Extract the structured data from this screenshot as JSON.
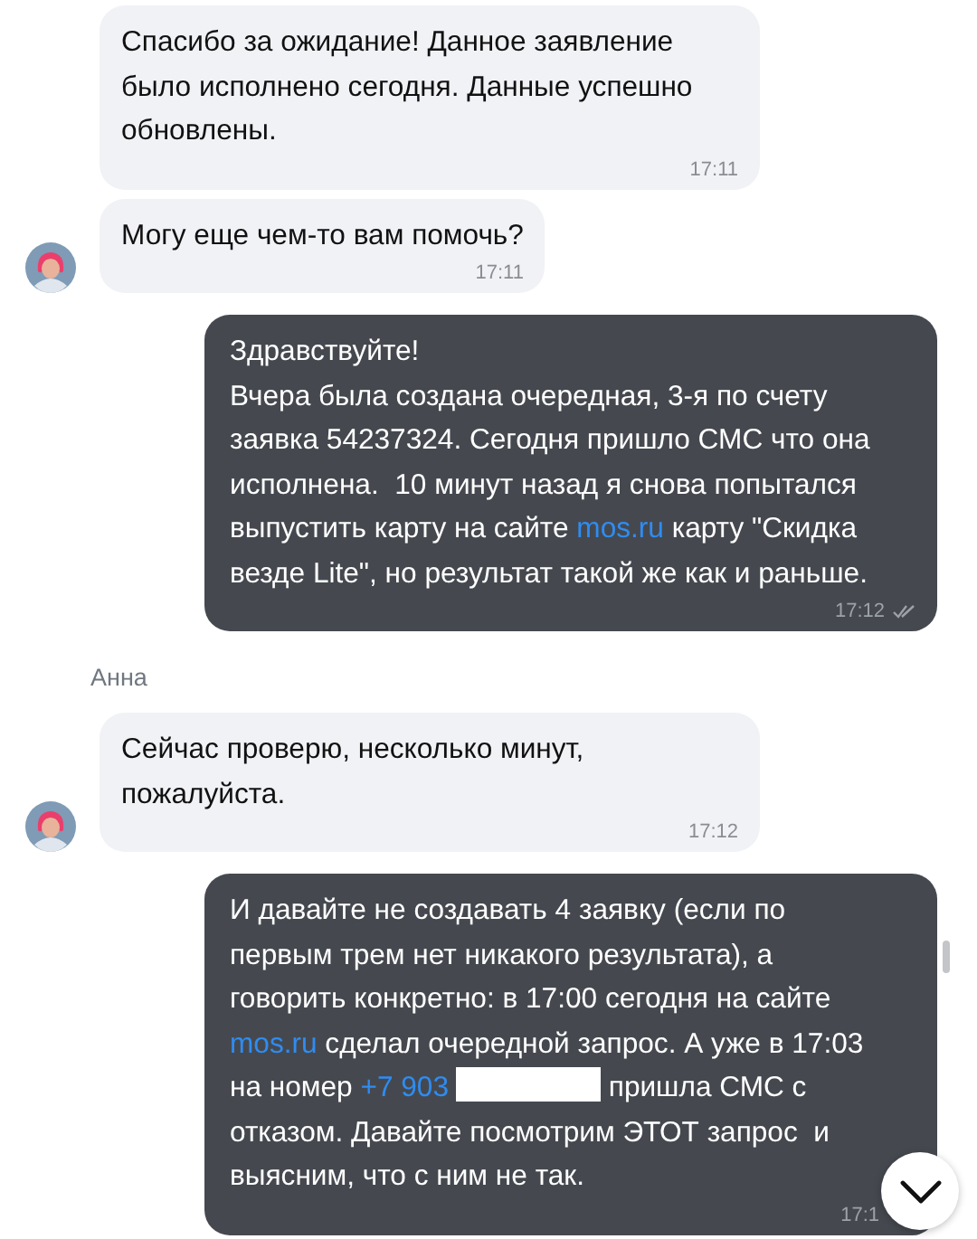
{
  "messages": [
    {
      "kind": "incoming",
      "avatar": false,
      "segments": [
        {
          "kind": "text",
          "text": "Спасибо за ожидание! Данное заявление\nбыло исполнено сегодня. Данные успешно\nобновлены."
        }
      ],
      "time": "17:11"
    },
    {
      "kind": "incoming",
      "avatar": true,
      "segments": [
        {
          "kind": "text",
          "text": "Могу еще чем-то вам помочь?"
        }
      ],
      "time": "17:11"
    },
    {
      "kind": "outgoing",
      "read": true,
      "segments": [
        {
          "kind": "text",
          "text": "Здравствуйте!\nВчера была создана очередная, 3-я по счету\nзаявка 54237324. Сегодня пришло СМС что она\nисполнена.  10 минут назад я снова попытался\nвыпустить карту на сайте "
        },
        {
          "kind": "link",
          "text": "mos.ru"
        },
        {
          "kind": "text",
          "text": " карту \"Скидка\nвезде Lite\", но результат такой же как и раньше."
        }
      ],
      "time": "17:12"
    },
    {
      "kind": "incoming",
      "avatar": true,
      "sender": "Анна",
      "segments": [
        {
          "kind": "text",
          "text": "Сейчас проверю, несколько минут,\nпожалуйста."
        }
      ],
      "time": "17:12"
    },
    {
      "kind": "outgoing",
      "read": false,
      "segments": [
        {
          "kind": "text",
          "text": "И давайте не создавать 4 заявку (если по\nпервым трем нет никакого результата), а\nговорить конкретно: в 17:00 сегодня на сайте\n"
        },
        {
          "kind": "link",
          "text": "mos.ru"
        },
        {
          "kind": "text",
          "text": " сделал очередной запрос. А уже в 17:03\nна номер "
        },
        {
          "kind": "link",
          "text": "+7 903"
        },
        {
          "kind": "redacted"
        },
        {
          "kind": "text",
          "text": " пришла СМС с\nотказом. Давайте посмотрим ЭТОТ запрос  и\nвыясним, что с ним не так."
        }
      ],
      "time": "17:1"
    }
  ]
}
